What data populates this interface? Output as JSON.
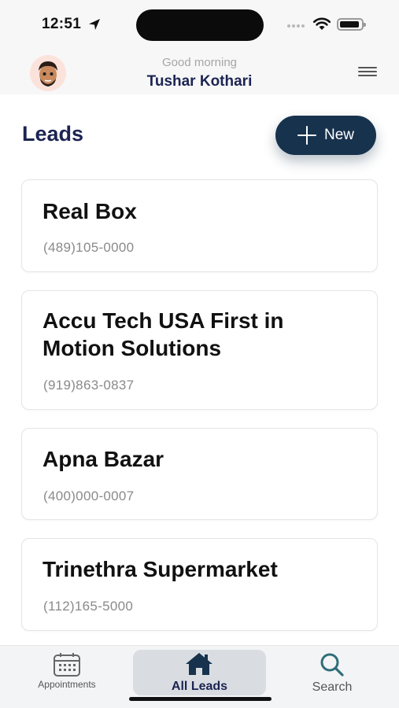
{
  "status_bar": {
    "time": "12:51"
  },
  "header": {
    "greeting": "Good morning",
    "user_name": "Tushar Kothari",
    "avatar_icon": "memoji-avatar-icon",
    "menu_icon": "hamburger-menu-icon"
  },
  "page": {
    "title": "Leads",
    "new_button_label": "New"
  },
  "leads": [
    {
      "name": "Real Box",
      "phone": "(489)105-0000"
    },
    {
      "name": "Accu Tech USA First in Motion Solutions",
      "phone": "(919)863-0837"
    },
    {
      "name": "Apna Bazar",
      "phone": "(400)000-0007"
    },
    {
      "name": "Trinethra Supermarket",
      "phone": "(112)165-5000"
    }
  ],
  "tabs": [
    {
      "label": "Appointments",
      "icon": "calendar-icon",
      "active": false
    },
    {
      "label": "All Leads",
      "icon": "home-icon",
      "active": true
    },
    {
      "label": "Search",
      "icon": "search-icon",
      "active": false
    }
  ],
  "colors": {
    "brand_navy": "#1c2452",
    "button_dark": "#17324d",
    "active_tab_bg": "#d9dde2",
    "phone_gray": "#8a8a8a"
  }
}
